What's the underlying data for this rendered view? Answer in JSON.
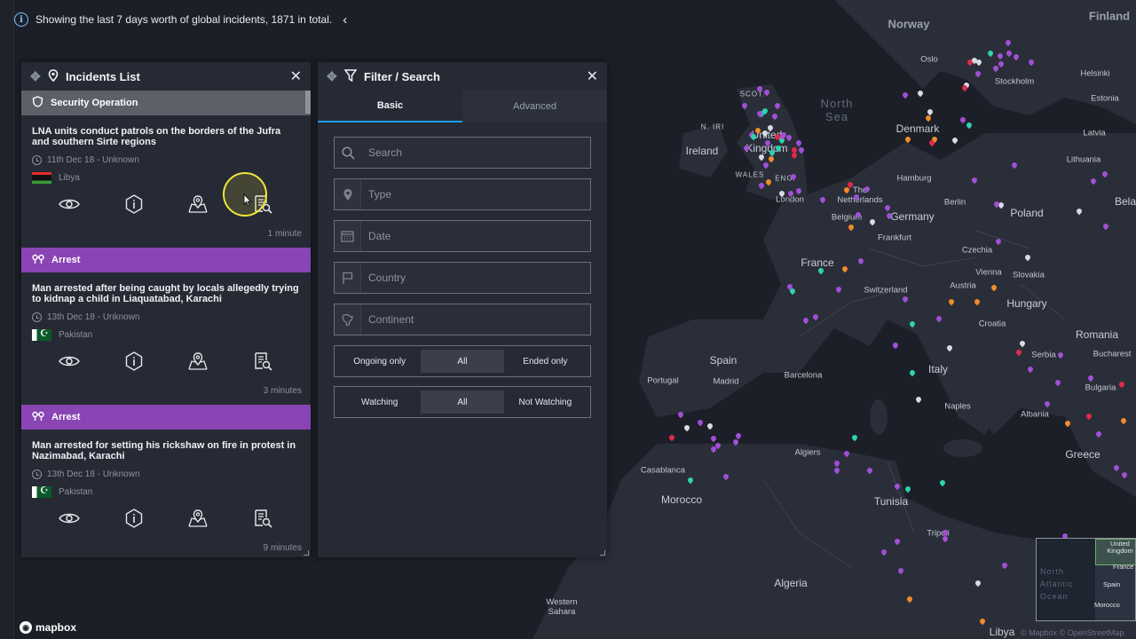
{
  "topbar": {
    "message": "Showing the last 7 days worth of global incidents, 1871 in total."
  },
  "incidents_panel": {
    "title": "Incidents List",
    "items": [
      {
        "category": "Security Operation",
        "title": "LNA units conduct patrols on the borders of the Jufra and southern Sirte regions",
        "date": "11th Dec 18 - Unknown",
        "country": "Libya",
        "time_ago": "1 minute"
      },
      {
        "category": "Arrest",
        "title": "Man arrested after being caught by locals allegedly trying to kidnap a child in Liaquatabad, Karachi",
        "date": "13th Dec 18 - Unknown",
        "country": "Pakistan",
        "time_ago": "3 minutes"
      },
      {
        "category": "Arrest",
        "title": "Man arrested for setting his rickshaw on fire in protest in Nazimabad, Karachi",
        "date": "13th Dec 18 - Unknown",
        "country": "Pakistan",
        "time_ago": "9 minutes"
      }
    ]
  },
  "filter_panel": {
    "title": "Filter / Search",
    "tabs": [
      "Basic",
      "Advanced"
    ],
    "active_tab": "Basic",
    "fields": {
      "search": "Search",
      "type": "Type",
      "date": "Date",
      "country": "Country",
      "continent": "Continent"
    },
    "status_segment": {
      "options": [
        "Ongoing only",
        "All",
        "Ended only"
      ],
      "selected": "All"
    },
    "watch_segment": {
      "options": [
        "Watching",
        "All",
        "Not Watching"
      ],
      "selected": "All"
    }
  },
  "map": {
    "labels": {
      "norway": "Norway",
      "finland": "Finland",
      "oslo": "Oslo",
      "stockholm": "Stockholm",
      "helsinki": "Helsinki",
      "estonia": "Estonia",
      "latvia": "Latvia",
      "lithuania": "Lithuania",
      "north_sea": "North Sea",
      "scot": "SCOT.",
      "n_iri": "N. IRI",
      "united_kingdom": "United Kingdom",
      "ireland": "Ireland",
      "wales": "WALES",
      "eng": "ENG.",
      "london": "London",
      "denmark": "Denmark",
      "hamburg": "Hamburg",
      "the_netherlands": "The Netherlands",
      "belgium": "Belgium",
      "germany": "Germany",
      "berlin": "Berlin",
      "poland": "Poland",
      "bela": "Bela",
      "frankfurt": "Frankfurt",
      "czechia": "Czechia",
      "france": "France",
      "vienna": "Vienna",
      "slovakia": "Slovakia",
      "switzerland": "Switzerland",
      "austria": "Austria",
      "hungary": "Hungary",
      "croatia": "Croatia",
      "romania": "Romania",
      "spain": "Spain",
      "portugal": "Portugal",
      "madrid": "Madrid",
      "barcelona": "Barcelona",
      "italy": "Italy",
      "serbia": "Serbia",
      "bucharest": "Bucharest",
      "bulgaria": "Bulgaria",
      "naples": "Naples",
      "albania": "Albania",
      "algiers": "Algiers",
      "casablanca": "Casablanca",
      "morocco": "Morocco",
      "tunisia": "Tunisia",
      "greece": "Greece",
      "tripoli": "Tripoli",
      "algeria": "Algeria",
      "western_sahara": "Western Sahara",
      "libya": "Libya"
    },
    "attribution": "© Mapbox © OpenStreetMap",
    "logo": "mapbox"
  },
  "minimap": {
    "labels": {
      "united_kingdom": "United Kingdom",
      "france": "France",
      "spain": "Spain",
      "morocco": "Morocco",
      "north_atlantic_ocean": "North Atlantic Ocean"
    }
  },
  "colors": {
    "arrest": "#8a45b5",
    "security_operation": "#5c6169",
    "accent_tab": "#1e9be9",
    "pin_purple": "#a24fd8",
    "pin_orange": "#f08c2a",
    "pin_teal": "#2fd3b0",
    "pin_red": "#e02a4a",
    "pin_white": "#d8dbe0"
  }
}
